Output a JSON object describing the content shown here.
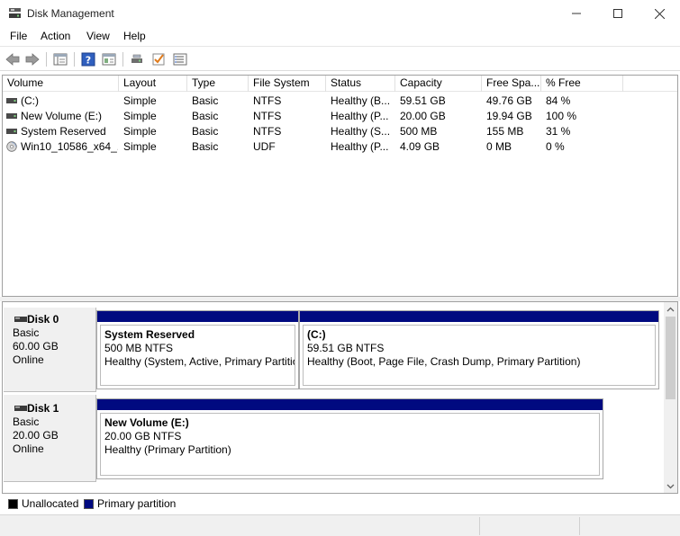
{
  "window": {
    "title": "Disk Management",
    "minimize_glyph": "—",
    "maximize_glyph": "☐",
    "close_glyph": "✕"
  },
  "menu": [
    "File",
    "Action",
    "View",
    "Help"
  ],
  "toolbar": {
    "icons": [
      "back-arrow-icon",
      "forward-arrow-icon",
      "properties-list-icon",
      "help-icon",
      "console-view-icon",
      "connect-drive-icon",
      "check-icon",
      "settings-list-icon"
    ]
  },
  "columns": [
    "Volume",
    "Layout",
    "Type",
    "File System",
    "Status",
    "Capacity",
    "Free Spa...",
    "% Free"
  ],
  "volumes": [
    {
      "volume": " (C:)",
      "layout": "Simple",
      "type": "Basic",
      "fs": "NTFS",
      "status": "Healthy (B...",
      "capacity": "59.51 GB",
      "free": "49.76 GB",
      "pct": "84 %",
      "icon": "drive-icon"
    },
    {
      "volume": "New Volume (E:)",
      "layout": "Simple",
      "type": "Basic",
      "fs": "NTFS",
      "status": "Healthy (P...",
      "capacity": "20.00 GB",
      "free": "19.94 GB",
      "pct": "100 %",
      "icon": "drive-icon"
    },
    {
      "volume": "System Reserved",
      "layout": "Simple",
      "type": "Basic",
      "fs": "NTFS",
      "status": "Healthy (S...",
      "capacity": "500 MB",
      "free": "155 MB",
      "pct": "31 %",
      "icon": "drive-icon"
    },
    {
      "volume": "Win10_10586_x64_...",
      "layout": "Simple",
      "type": "Basic",
      "fs": "UDF",
      "status": "Healthy (P...",
      "capacity": "4.09 GB",
      "free": "0 MB",
      "pct": "0 %",
      "icon": "cd-drive-icon"
    }
  ],
  "disks": [
    {
      "name": "Disk 0",
      "type": "Basic",
      "size": "60.00 GB",
      "state": "Online",
      "partitions": [
        {
          "label": "System Reserved",
          "size": "500 MB NTFS",
          "status": "Healthy (System, Active, Primary Partition)"
        },
        {
          "label": "  (C:)",
          "size": "59.51 GB NTFS",
          "status": "Healthy (Boot, Page File, Crash Dump, Primary Partition)"
        }
      ]
    },
    {
      "name": "Disk 1",
      "type": "Basic",
      "size": "20.00 GB",
      "state": "Online",
      "partitions": [
        {
          "label": "New Volume  (E:)",
          "size": "20.00 GB NTFS",
          "status": "Healthy (Primary Partition)"
        }
      ]
    }
  ],
  "legend": [
    {
      "label": "Unallocated",
      "color": "#000000"
    },
    {
      "label": "Primary partition",
      "color": "#000a80"
    }
  ],
  "colors": {
    "primary_partition": "#000a80",
    "unallocated": "#000000"
  }
}
